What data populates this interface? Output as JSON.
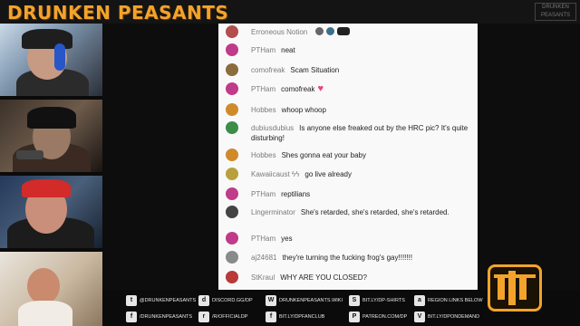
{
  "header": {
    "brand": "DRUNKEN PEASANTS",
    "corner_logo": "DRUNKEN PEASANTS"
  },
  "colors": {
    "brand": "#f3a32b",
    "chat_bg": "#f9f9f9",
    "username": "#7a7a7a",
    "heart": "#e8457a"
  },
  "chat": {
    "messages": [
      {
        "user": "Erroneous Notion",
        "text": "",
        "avatar_color": "#b34e4e"
      },
      {
        "user": "PTHam",
        "text": "neat",
        "avatar_color": "#c03b8a"
      },
      {
        "user": "comofreak",
        "text": "Scam Situation",
        "avatar_color": "#8c6b3d"
      },
      {
        "user": "PTHam",
        "text": "comofreak",
        "avatar_color": "#c03b8a"
      },
      {
        "user": "Hobbes",
        "text": "whoop whoop",
        "avatar_color": "#d08a2a"
      },
      {
        "user": "dubiusdubius",
        "text": "Is anyone else freaked out by the HRC pic? It's quite disturbing!",
        "avatar_color": "#3c8d4a"
      },
      {
        "user": "Hobbes",
        "text": "Shes gonna eat your baby",
        "avatar_color": "#d08a2a"
      },
      {
        "user": "Kawaiicaust ϟϟ",
        "text": "go live already",
        "avatar_color": "#b8a03c"
      },
      {
        "user": "PTHam",
        "text": "reptilians",
        "avatar_color": "#c03b8a"
      },
      {
        "user": "Lingerminator",
        "text": "She's retarded, she's retarded, she's retarded.",
        "avatar_color": "#444444"
      },
      {
        "user": "PTHam",
        "text": "yes",
        "avatar_color": "#c03b8a"
      },
      {
        "user": "aj24681",
        "text": "they're turning the fucking frog's gay!!!!!!!",
        "avatar_color": "#8a8a8a"
      },
      {
        "user": "StKraul",
        "text": "WHY ARE YOU CLOSED?",
        "avatar_color": "#b83a3a"
      }
    ]
  },
  "footer": {
    "links": [
      {
        "icon": "twitter-icon",
        "glyph": "t",
        "text": "@DRUNKENPEASANTS"
      },
      {
        "icon": "facebook-icon",
        "glyph": "f",
        "text": "/DRUNKENPEASANTS"
      },
      {
        "icon": "discord-icon",
        "glyph": "d",
        "text": "DISCORD.GG/DP"
      },
      {
        "icon": "reddit-icon",
        "glyph": "r",
        "text": "/R/OFFICIALDP"
      },
      {
        "icon": "wiki-icon",
        "glyph": "W",
        "text": "DRUNKENPEASANTS.WIKI"
      },
      {
        "icon": "fanclub-icon",
        "glyph": "f",
        "text": "BIT.LY/DPFANCLUB"
      },
      {
        "icon": "shirt-icon",
        "glyph": "S",
        "text": "BIT.LY/DP-SHIRTS"
      },
      {
        "icon": "patreon-icon",
        "glyph": "P",
        "text": "PATREON.COM/DP"
      },
      {
        "icon": "amazon-icon",
        "glyph": "a",
        "text": "REGION LINKS BELOW"
      },
      {
        "icon": "vimeo-icon",
        "glyph": "V",
        "text": "BIT.LY/DPONDEMAND"
      }
    ]
  }
}
